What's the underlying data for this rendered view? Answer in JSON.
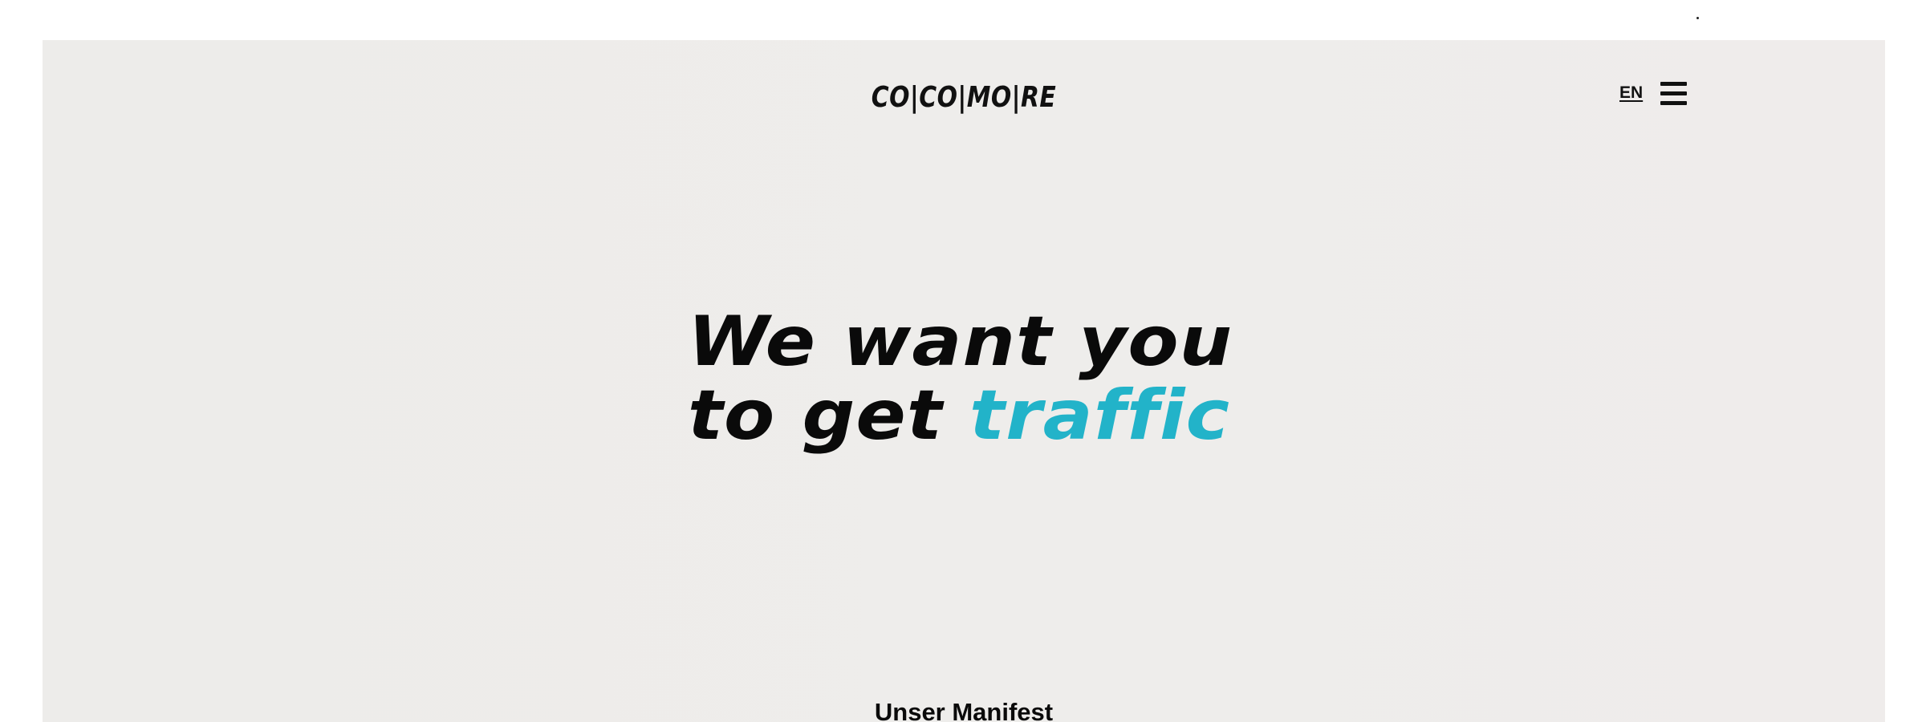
{
  "header": {
    "logo_text": "CO|CO|MO|RE",
    "language_label": "EN",
    "menu_icon": "hamburger-menu-icon"
  },
  "hero": {
    "line1": "We want you",
    "line2_prefix": "to get",
    "line2_accent": "traffic",
    "accent_color": "#22b3c9"
  },
  "section": {
    "manifest_title": "Unser Manifest"
  },
  "colors": {
    "page_background": "#edecea",
    "text": "#0a0a0a"
  }
}
